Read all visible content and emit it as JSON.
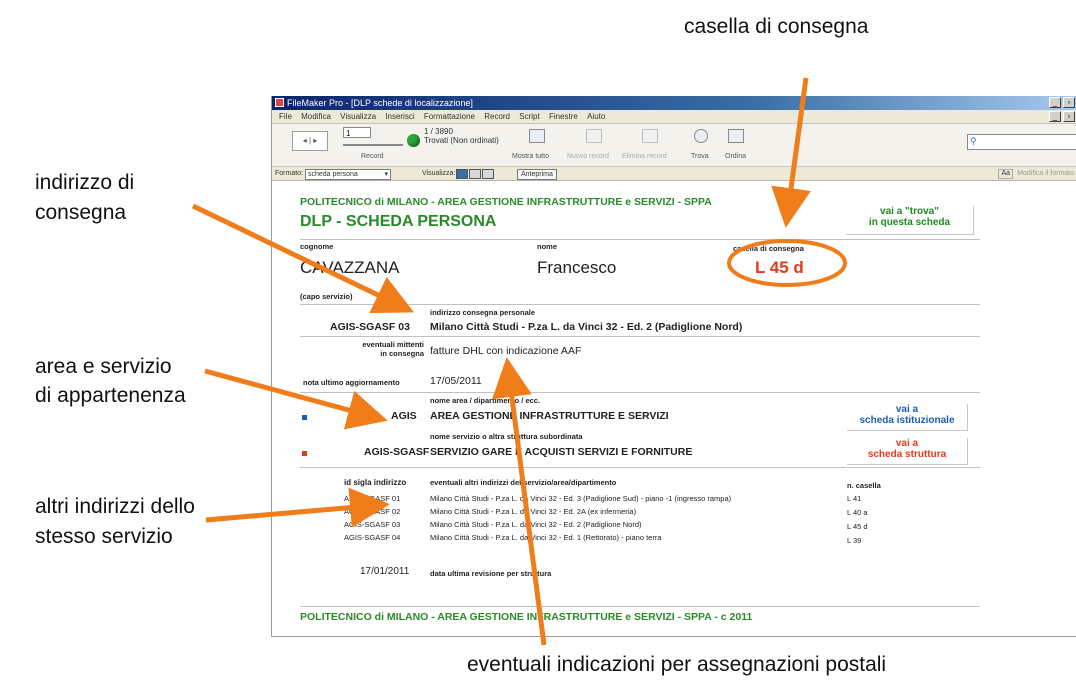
{
  "callouts": {
    "casella": "casella di consegna",
    "indirizzo_l1": "indirizzo di",
    "indirizzo_l2": "consegna",
    "area_l1": "area e servizio",
    "area_l2": "di appartenenza",
    "altri_l1": "altri indirizzi dello",
    "altri_l2": "stesso servizio",
    "eventuali": "eventuali indicazioni per assegnazioni postali"
  },
  "window": {
    "title": "FileMaker Pro - [DLP schede di localizzazione]",
    "menu": [
      "File",
      "Modifica",
      "Visualizza",
      "Inserisci",
      "Formattazione",
      "Record",
      "Script",
      "Finestre",
      "Aiuto"
    ]
  },
  "toolbar": {
    "record_input": "1",
    "record_label": "Record",
    "record_count": "1 / 3890",
    "found_text": "Trovati (Non ordinati)",
    "buttons": [
      "Mostra tutto",
      "Nuovo record",
      "Elimina record",
      "Trova",
      "Ordina"
    ]
  },
  "statusbar": {
    "formato_label": "Formato:",
    "formato_value": "scheda persona",
    "visualizza_label": "Visualizza:",
    "anteprima": "Anteprima",
    "aa": "Aa",
    "modifica_formato": "Modifica il formato"
  },
  "colors": {
    "green": "#2a8a2a",
    "blue": "#1a5fb4",
    "red": "#e23a1a",
    "orange": "#f07c1a"
  },
  "layout": {
    "header_org": "POLITECNICO di MILANO - AREA GESTIONE INFRASTRUTTURE e SERVIZI - SPPA",
    "header_title": "DLP - SCHEDA PERSONA",
    "link_trova_l1": "vai a \"trova\"",
    "link_trova_l2": "in questa scheda",
    "cognome_label": "cognome",
    "cognome": "CAVAZZANA",
    "nome_label": "nome",
    "nome": "Francesco",
    "casella_label": "casella di consegna",
    "casella": "L 45 d",
    "capo": "(capo servizio)",
    "indirizzo_label": "indirizzo consegna personale",
    "indirizzo_code": "AGIS-SGASF 03",
    "indirizzo": "Milano Città Studi - P.za L. da Vinci 32  - Ed. 2 (Padiglione Nord)",
    "mittenti_label_l1": "eventuali mittenti",
    "mittenti_label_l2": "in consegna",
    "mittenti": "fatture DHL con indicazione AAF",
    "nota_label": "nota ultimo aggiornamento",
    "nota": "17/05/2011",
    "area_label": "nome area / dipartimento / ecc.",
    "area_code": "AGIS",
    "area_name": "AREA GESTIONE INFRASTRUTTURE E SERVIZI",
    "link_ist_l1": "vai a",
    "link_ist_l2": "scheda istituzionale",
    "servizio_label": "nome servizio o altra struttura subordinata",
    "servizio_code": "AGIS-SGASF",
    "servizio_name": "SERVIZIO GARE E ACQUISTI SERVIZI E FORNITURE",
    "link_str_l1": "vai a",
    "link_str_l2": "scheda struttura",
    "tbl_col1": "id sigla indirizzo",
    "tbl_col2": "eventuali altri indirizzi del servizio/area/dipartimento",
    "tbl_col3": "n. casella",
    "rows": [
      {
        "id": "AGIS-SGASF 01",
        "addr": "Milano Città Studi - P.za L. da Vinci 32  - Ed. 3 (Padiglione Sud) - piano -1 (ingresso rampa)",
        "cas": "L 41"
      },
      {
        "id": "AGIS-SGASF 02",
        "addr": "Milano Città Studi - P.za L. da Vinci 32  - Ed. 2A (ex infermeria)",
        "cas": "L 40 a"
      },
      {
        "id": "AGIS-SGASF 03",
        "addr": "Milano Città Studi - P.za L. da Vinci 32  - Ed. 2 (Padiglione Nord)",
        "cas": "L 45 d"
      },
      {
        "id": "AGIS-SGASF 04",
        "addr": "Milano Città Studi - P.za L. da Vinci 32  - Ed. 1 (Rettorato) - piano terra",
        "cas": "L 39"
      }
    ],
    "revisione_date": "17/01/2011",
    "revisione_label": "data ultima revisione per struttura",
    "footer": "POLITECNICO di MILANO - AREA GESTIONE INFRASTRUTTURE e SERVIZI - SPPA -  c 2011"
  }
}
